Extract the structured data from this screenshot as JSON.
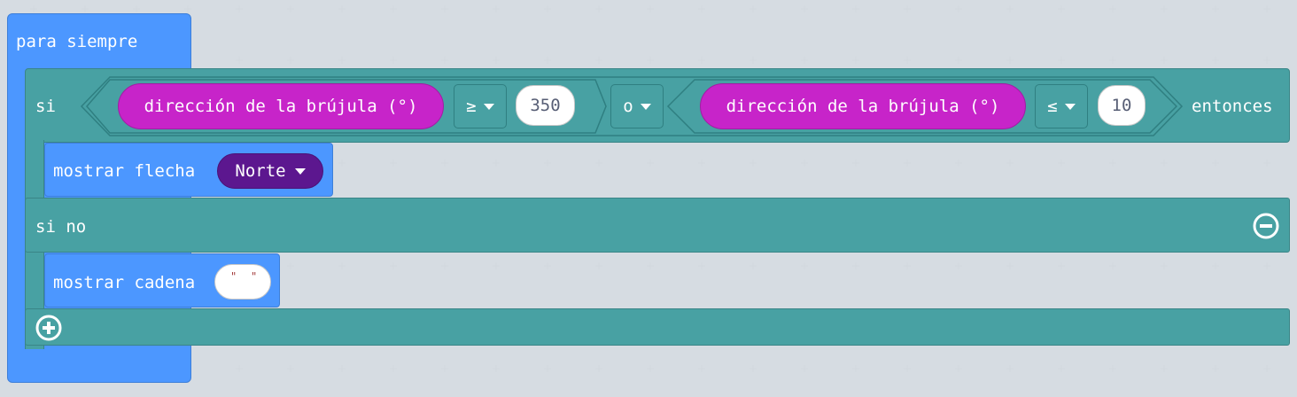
{
  "forever_block": {
    "label": "para siempre"
  },
  "if_block": {
    "if_label": "si",
    "then_label": "entonces",
    "condition": {
      "left": {
        "reporter": "dirección de la brújula (°)",
        "operator": "≥",
        "value": "350"
      },
      "logic_operator": "o",
      "right": {
        "reporter": "dirección de la brújula (°)",
        "operator": "≤",
        "value": "10"
      }
    },
    "then_body": {
      "statement": "mostrar flecha",
      "argument": "Norte"
    },
    "else_label": "si no",
    "else_body": {
      "statement": "mostrar cadena",
      "string_value": ""
    }
  },
  "icons": {
    "remove_else": "minus-circle-icon",
    "add_branch": "plus-circle-icon",
    "dropdown": "caret-down-icon"
  },
  "colors": {
    "background": "#ebeef1",
    "basic_blue": "#4c97ff",
    "logic_teal": "#48a1a3",
    "input_magenta": "#c724c9",
    "arrow_purple": "#5c178f"
  }
}
